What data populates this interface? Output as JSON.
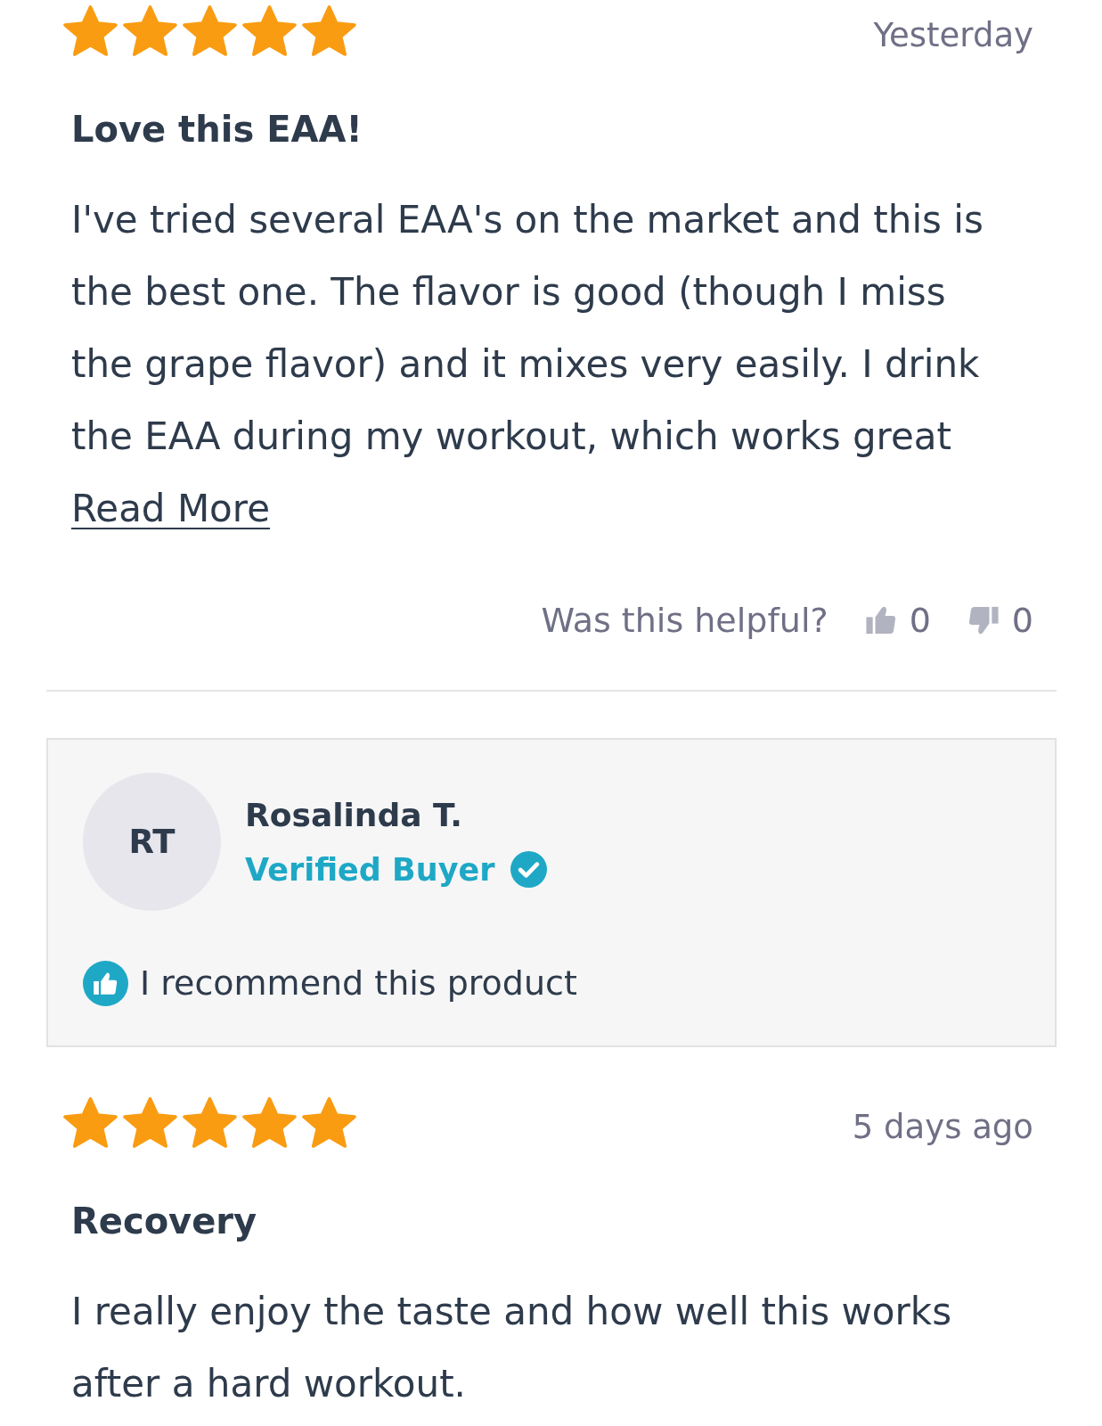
{
  "reviews": [
    {
      "stars": 5,
      "date": "Yesterday",
      "title": "Love this EAA!",
      "body": "I've tried several EAA's on the market and this is the best one. The flavor is good (though I miss the grape flavor) and it mixes very easily. I drink the EAA during my workout, which works great",
      "read_more": "Read More",
      "helpful": {
        "prompt": "Was this helpful?",
        "up_count": "0",
        "down_count": "0"
      }
    },
    {
      "reviewer": {
        "initials": "RT",
        "name": "Rosalinda T.",
        "badge": "Verified Buyer",
        "recommendation": "I recommend this product"
      },
      "stars": 5,
      "date": "5 days ago",
      "title": "Recovery",
      "body": "I really enjoy the taste and how well this works after a hard workout."
    }
  ]
}
